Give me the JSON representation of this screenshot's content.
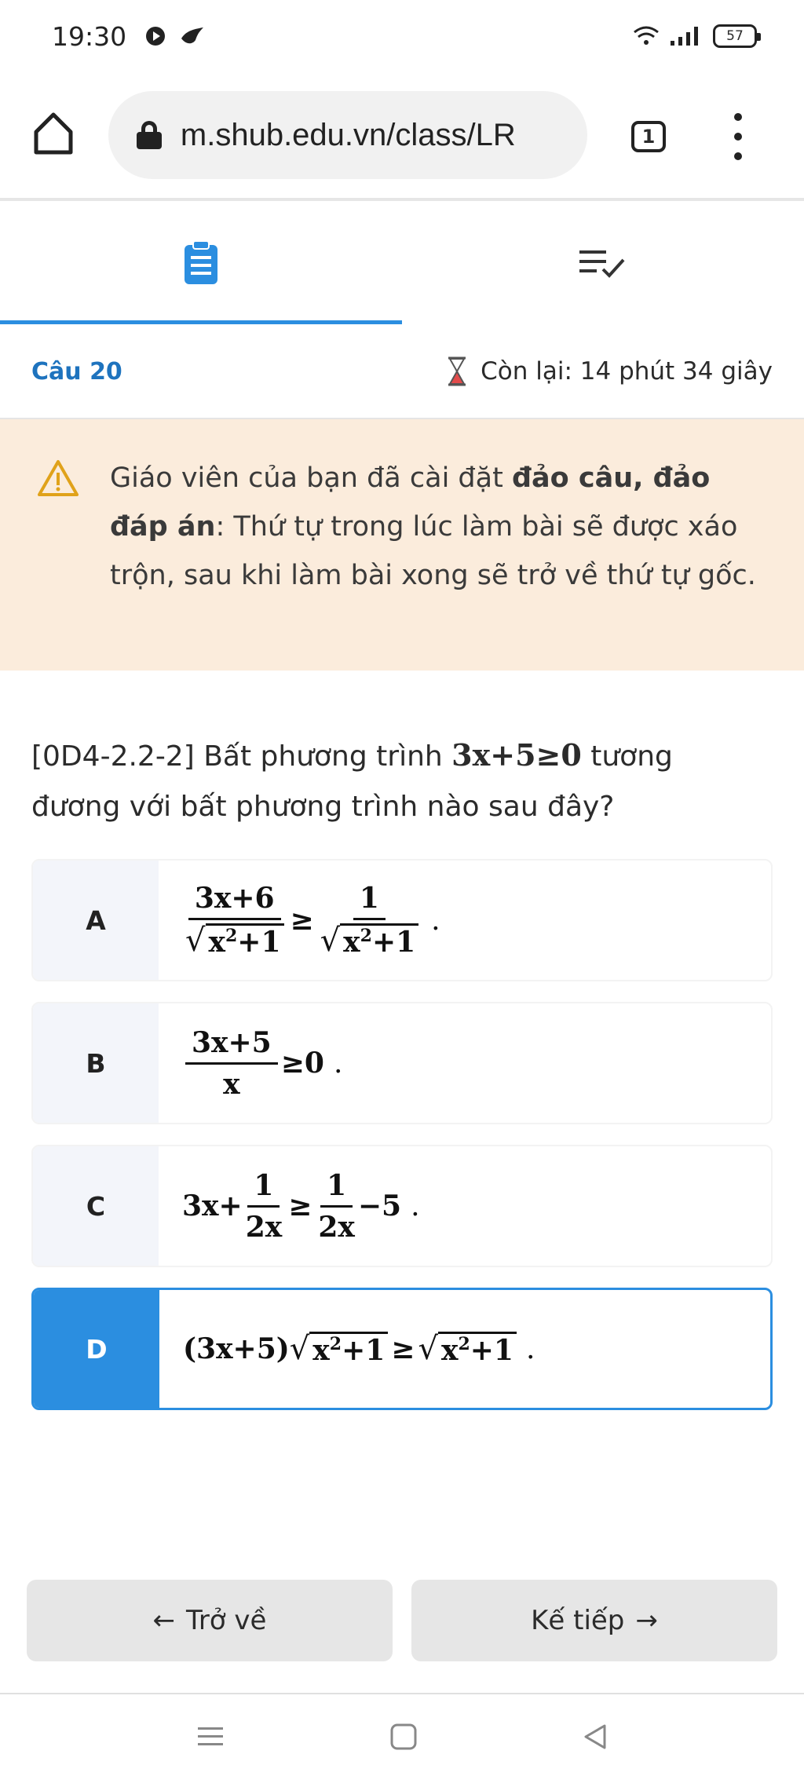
{
  "status_bar": {
    "time": "19:30",
    "battery": "57"
  },
  "browser": {
    "url": "m.shub.edu.vn/class/LR",
    "tab_count": "1"
  },
  "tabs": [
    {
      "name": "questions",
      "icon": "clipboard-icon",
      "active": true
    },
    {
      "name": "answer-list",
      "icon": "checklist-icon",
      "active": false
    }
  ],
  "question_header": {
    "number": "Câu 20",
    "timer_label": "Còn lại: 14 phút 34 giây"
  },
  "warning": {
    "text_1": "Giáo viên của bạn đã cài đặt ",
    "bold": "đảo câu, đảo đáp án",
    "text_2": ": Thứ tự trong lúc làm bài sẽ được xáo trộn, sau khi làm bài xong sẽ trở về thứ tự gốc."
  },
  "question": {
    "code": "[0D4-2.2-2]",
    "text_before": " Bất phương trình ",
    "math": "3x+5≥0",
    "text_after": "  tương đương với bất phương trình nào sau đây?"
  },
  "answers": [
    {
      "letter": "A",
      "selected": false
    },
    {
      "letter": "B",
      "selected": false
    },
    {
      "letter": "C",
      "selected": false
    },
    {
      "letter": "D",
      "selected": true
    }
  ],
  "math": {
    "a_num1": "3x+6",
    "a_rad1": "x",
    "a_sup": "2",
    "a_plus1": "+1",
    "a_ge": "≥",
    "a_num2": "1",
    "b_num": "3x+5",
    "b_den": "x",
    "b_rhs": "≥0",
    "c_lhs": "3x+",
    "c_one": "1",
    "c_den": "2x",
    "c_ge": "≥",
    "c_minus": "−5",
    "d_lhs": "(3x+5)",
    "d_ge": "≥",
    "period": "."
  },
  "buttons": {
    "back": "Trở về",
    "next": "Kế tiếp"
  },
  "colors": {
    "accent": "#2b8ee0",
    "warning_bg": "#fbecdc",
    "question_number": "#1e73be"
  }
}
